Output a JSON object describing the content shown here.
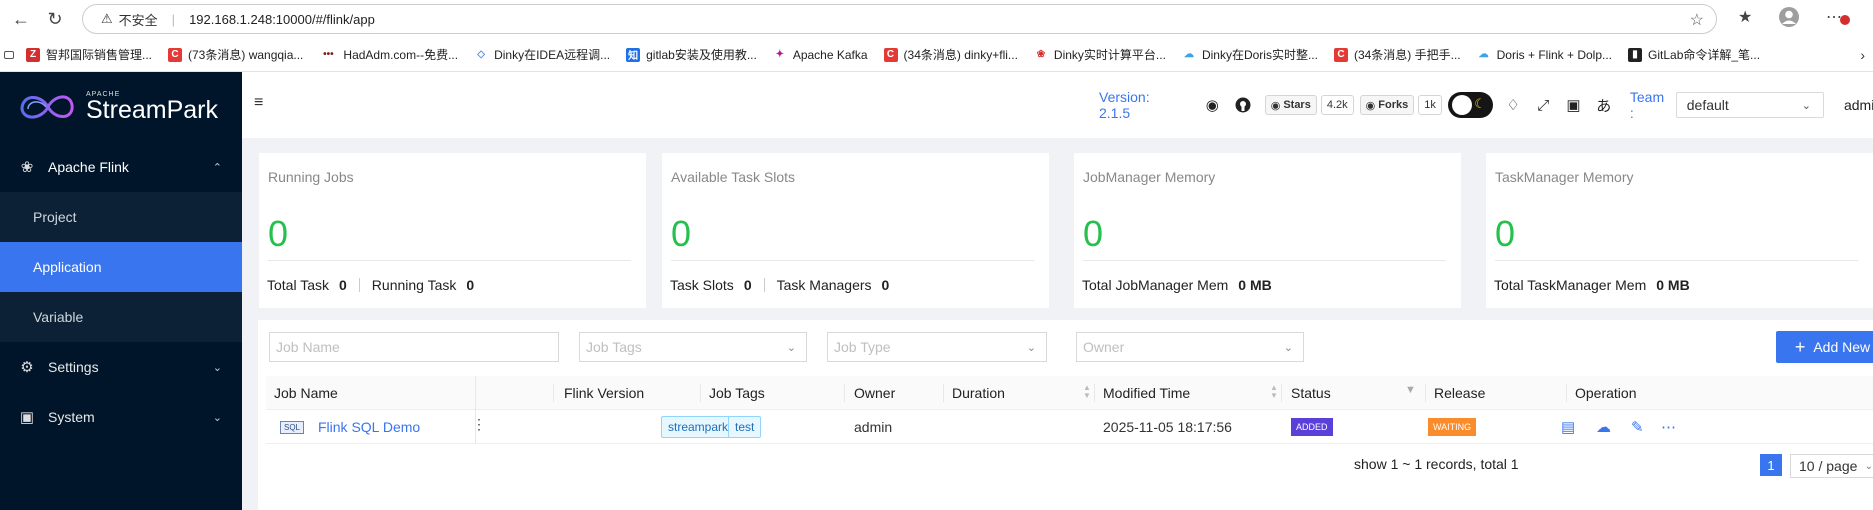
{
  "browser": {
    "insecure_label": "不安全",
    "url": "192.168.1.248:10000/#/flink/app",
    "bookmarks": [
      {
        "label": "智邦国际销售管理...",
        "color": "#d32f2f",
        "glyph": "Z"
      },
      {
        "label": "(73条消息) wangqia...",
        "color": "#e53935",
        "glyph": "C"
      },
      {
        "label": "HadAdm.com--免费...",
        "color": "#7b1f1f",
        "glyph": "•••"
      },
      {
        "label": "Dinky在IDEA远程调...",
        "color": "#5b8ee6",
        "glyph": "◇"
      },
      {
        "label": "gitlab安装及使用教...",
        "color": "#1e6fe8",
        "glyph": "知"
      },
      {
        "label": "Apache Kafka",
        "color": "#b21b8f",
        "glyph": "✦"
      },
      {
        "label": "(34条消息) dinky+fli...",
        "color": "#e53935",
        "glyph": "C"
      },
      {
        "label": "Dinky实时计算平台...",
        "color": "#d32f2f",
        "glyph": "❀"
      },
      {
        "label": "Dinky在Doris实时整...",
        "color": "#3ba3e8",
        "glyph": "☁"
      },
      {
        "label": "(34条消息) 手把手...",
        "color": "#e53935",
        "glyph": "C"
      },
      {
        "label": "Doris + Flink + Dolp...",
        "color": "#3ba3e8",
        "glyph": "☁"
      },
      {
        "label": "GitLab命令详解_笔...",
        "color": "#222222",
        "glyph": "▮"
      }
    ]
  },
  "app": {
    "logo_apache": "APACHE",
    "logo_name": "StreamPark",
    "version": "Version: 2.1.5",
    "stars_label": "Stars",
    "stars_count": "4.2k",
    "forks_label": "Forks",
    "forks_count": "1k",
    "team_label": "Team :",
    "team_value": "default",
    "user": "admin"
  },
  "sidebar": {
    "items": [
      {
        "label": "Apache Flink",
        "icon": "flink-squirrel-icon",
        "expanded": true
      },
      {
        "label": "Settings",
        "icon": "gear-icon"
      },
      {
        "label": "System",
        "icon": "monitor-icon"
      }
    ],
    "sub_items": [
      {
        "label": "Project"
      },
      {
        "label": "Application",
        "active": true
      },
      {
        "label": "Variable"
      }
    ]
  },
  "cards": [
    {
      "title": "Running Jobs",
      "value": "0",
      "foot": [
        {
          "label": "Total Task",
          "value": "0"
        },
        {
          "label": "Running Task",
          "value": "0"
        }
      ]
    },
    {
      "title": "Available Task Slots",
      "value": "0",
      "foot": [
        {
          "label": "Task Slots",
          "value": "0"
        },
        {
          "label": "Task Managers",
          "value": "0"
        }
      ]
    },
    {
      "title": "JobManager Memory",
      "value": "0",
      "foot": [
        {
          "label": "Total JobManager Mem",
          "value": "0 MB"
        }
      ]
    },
    {
      "title": "TaskManager Memory",
      "value": "0",
      "foot": [
        {
          "label": "Total TaskManager Mem",
          "value": "0 MB"
        }
      ]
    }
  ],
  "filters": {
    "job_name": "Job Name",
    "job_tags": "Job Tags",
    "job_type": "Job Type",
    "owner": "Owner"
  },
  "add_new": "Add New",
  "table": {
    "columns": [
      "Job Name",
      "Flink Version",
      "Job Tags",
      "Owner",
      "Duration",
      "Modified Time",
      "Status",
      "Release",
      "Operation"
    ],
    "rows": [
      {
        "type_badge": "SQL",
        "job_name": "Flink SQL Demo",
        "flink_version": "",
        "tags": [
          "streampark",
          "test"
        ],
        "owner": "admin",
        "duration": "",
        "modified_time": "2025-11-05 18:17:56",
        "status": "ADDED",
        "release": "WAITING"
      }
    ]
  },
  "pagination": {
    "summary": "show 1 ~ 1 records, total 1",
    "current_page": "1",
    "page_size": "10 / page"
  },
  "colors": {
    "accent": "#3a75f0",
    "sidebar_bg": "#001529",
    "value_green": "#26c04e",
    "status_added": "#5b3fd9",
    "release_waiting": "#fa8c2c"
  }
}
